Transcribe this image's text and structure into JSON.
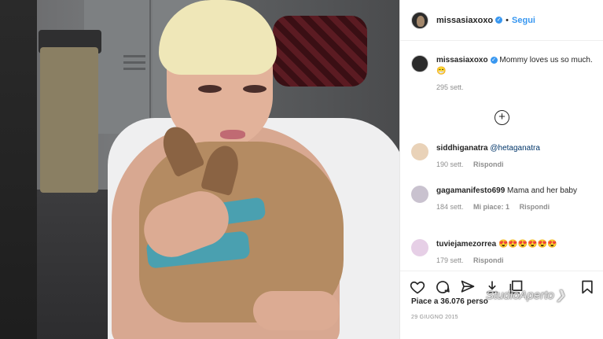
{
  "post": {
    "username": "missasiaxoxo",
    "follow_label": "Segui",
    "caption_user": "missasiaxoxo",
    "caption_text": "Mommy loves us so much.",
    "caption_emoji": "😁",
    "caption_time": "295 sett.",
    "load_more_icon": "plus-circle-icon"
  },
  "comments": [
    {
      "user": "siddhiganatra",
      "text": "@hetaganatra",
      "time": "190 sett.",
      "likes": "",
      "reply": "Rispondi"
    },
    {
      "user": "gagamanifesto699",
      "text": "Mama and her baby",
      "time": "184 sett.",
      "likes": "Mi piace: 1",
      "reply": "Rispondi"
    },
    {
      "user": "tuviejamezorrea",
      "text": "😍😍😍😍😍😍",
      "time": "179 sett.",
      "likes": "",
      "reply": "Rispondi"
    }
  ],
  "footer": {
    "likes_text": "Piace a 36.076 perso",
    "date": "29 GIUGNO 2015",
    "icons": [
      "heart-icon",
      "comment-icon",
      "share-icon",
      "save-icon",
      "bookmark-icon"
    ]
  },
  "watermark": {
    "text": "StudioAperto"
  },
  "colors": {
    "accent": "#3897f0",
    "text": "#262626",
    "muted": "#8e8e8e"
  }
}
